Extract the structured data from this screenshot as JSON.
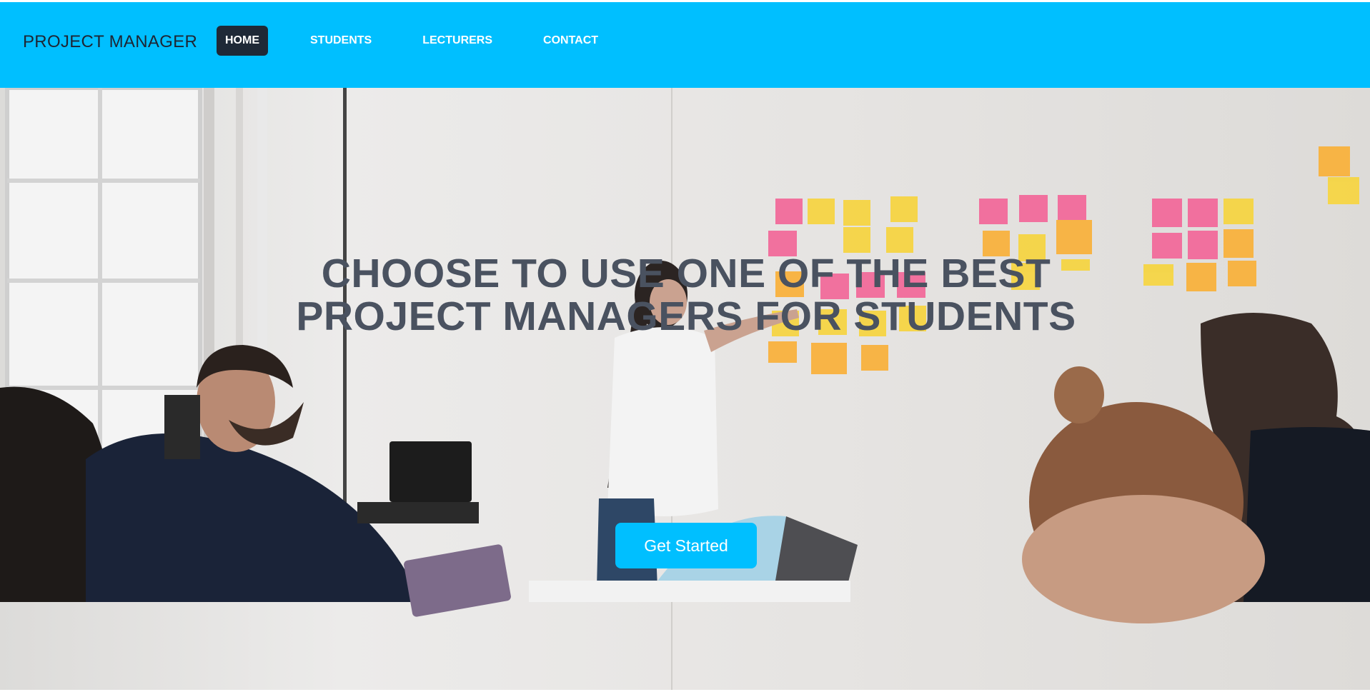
{
  "header": {
    "brand": "PROJECT MANAGER",
    "nav": [
      {
        "label": "HOME",
        "active": true
      },
      {
        "label": "STUDENTS",
        "active": false
      },
      {
        "label": "LECTURERS",
        "active": false
      },
      {
        "label": "CONTACT",
        "active": false
      }
    ]
  },
  "hero": {
    "title": "CHOOSE TO USE ONE OF THE BEST PROJECT MANAGERS FOR STUDENTS",
    "cta_label": "Get Started"
  },
  "colors": {
    "accent": "#00bfff",
    "active_nav": "#1f2937",
    "title_text": "#4a5260"
  }
}
